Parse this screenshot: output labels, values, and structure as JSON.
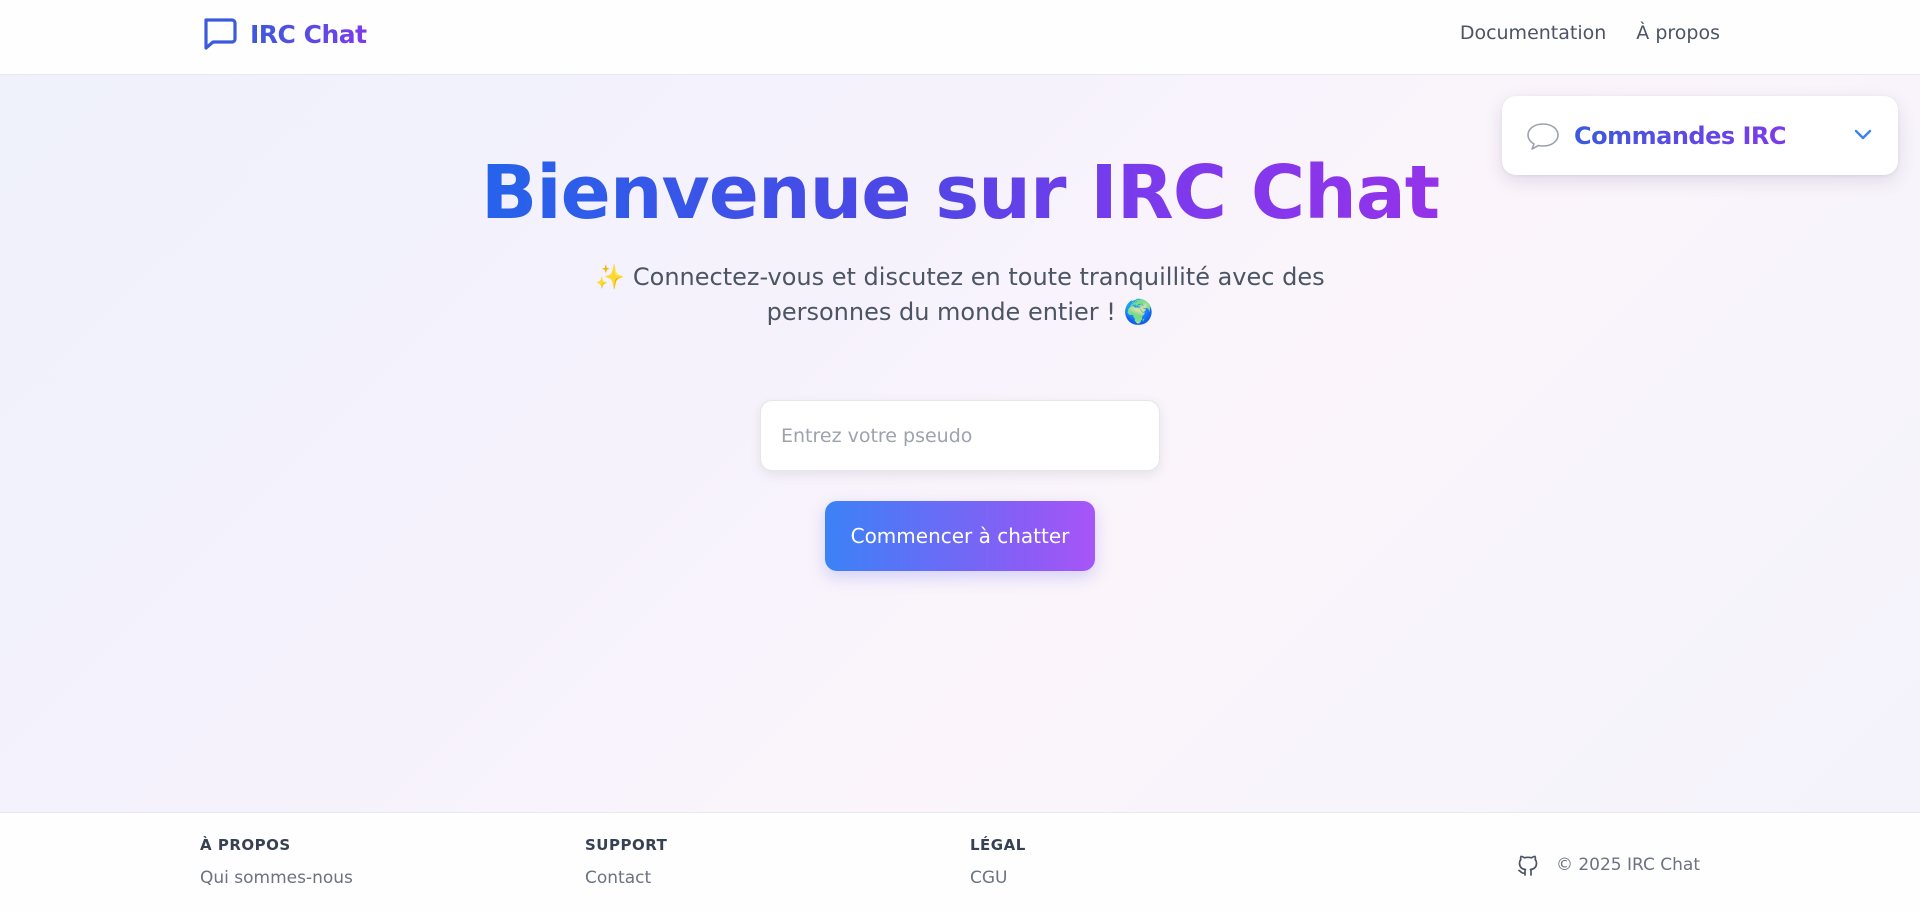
{
  "header": {
    "brand": "IRC Chat",
    "nav": [
      "Documentation",
      "À propos"
    ]
  },
  "commands_card": {
    "title": "Commandes IRC"
  },
  "hero": {
    "title": "Bienvenue sur IRC Chat",
    "subtitle": "✨ Connectez-vous et discutez en toute tranquillité avec des personnes du monde entier ! 🌍"
  },
  "form": {
    "pseudo_placeholder": "Entrez votre pseudo",
    "submit_label": "Commencer à chatter"
  },
  "footer": {
    "columns": [
      {
        "title": "À PROPOS",
        "link": "Qui sommes-nous"
      },
      {
        "title": "SUPPORT",
        "link": "Contact"
      },
      {
        "title": "LÉGAL",
        "link": "CGU"
      }
    ],
    "copyright": "© 2025 IRC Chat"
  },
  "colors": {
    "brand_blue": "#3b5bdb",
    "brand_purple": "#7c3aed",
    "button_start": "#3b82f6",
    "button_end": "#a855f7"
  },
  "icons": [
    "chat-bubble-icon",
    "speech-bubble-icon",
    "chevron-down-icon",
    "github-icon"
  ]
}
